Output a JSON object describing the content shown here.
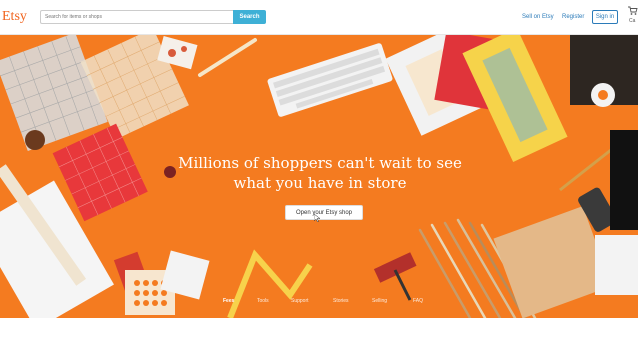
{
  "header": {
    "logo": "Etsy",
    "search_placeholder": "Search for items or shops",
    "search_button": "Search",
    "sell_link": "Sell on Etsy",
    "register_link": "Register",
    "signin_button": "Sign in",
    "cart_label": "Ca"
  },
  "hero": {
    "headline_line1": "Millions of shoppers can't wait to see",
    "headline_line2": "what you have in store",
    "cta_button": "Open your Etsy shop",
    "tabs": [
      "Fees",
      "Tools",
      "Support",
      "Stories",
      "Selling",
      "FAQ"
    ],
    "background_color": "#f47b20"
  },
  "colors": {
    "brand": "#f1641e",
    "search_button": "#3eb0d6",
    "link": "#2b7bb9"
  },
  "icons": [
    "cart-icon",
    "cursor-icon"
  ]
}
